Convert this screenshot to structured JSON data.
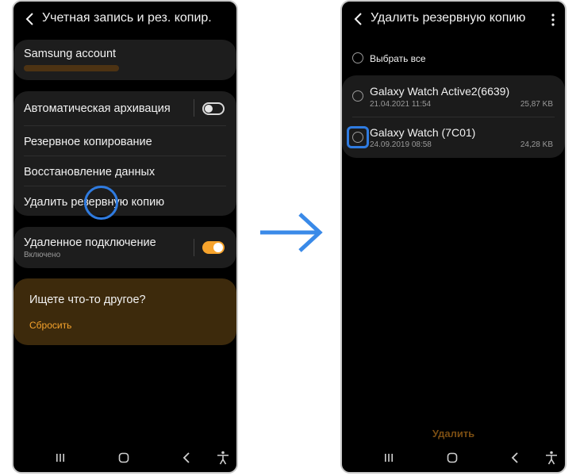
{
  "left_screen": {
    "title": "Учетная запись и рез. копир.",
    "account": {
      "label": "Samsung account"
    },
    "backup_section": {
      "auto_archive": {
        "label": "Автоматическая архивация",
        "enabled": false
      },
      "backup": {
        "label": "Резервное копирование"
      },
      "restore": {
        "label": "Восстановление данных"
      },
      "delete_backup": {
        "label": "Удалить резервную копию"
      }
    },
    "remote": {
      "label": "Удаленное подключение",
      "status": "Включено",
      "enabled": true
    },
    "suggestion": {
      "title": "Ищете что-то другое?",
      "link": "Сбросить"
    }
  },
  "right_screen": {
    "title": "Удалить резервную копию",
    "select_all": "Выбрать все",
    "items": [
      {
        "name": "Galaxy Watch Active2(6639)",
        "date": "21.04.2021 11:54",
        "size": "25,87 KB"
      },
      {
        "name": "Galaxy Watch (7C01)",
        "date": "24.09.2019 08:58",
        "size": "24,28 KB"
      }
    ],
    "delete_button": "Удалить"
  },
  "colors": {
    "accent_orange": "#f6a32c",
    "highlight_blue": "#2f7be0",
    "arrow_blue": "#3a8ae8"
  },
  "icons": [
    "back-icon",
    "more-icon",
    "recents-icon",
    "home-icon",
    "nav-back-icon",
    "accessibility-icon",
    "arrow-right-icon"
  ]
}
